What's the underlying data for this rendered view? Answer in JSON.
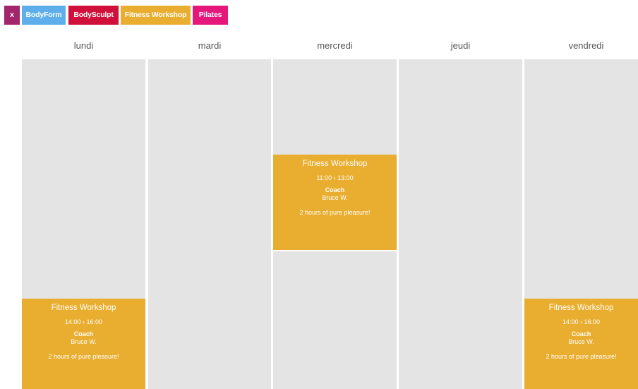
{
  "filters": [
    {
      "label": "x",
      "color": "#a3256c"
    },
    {
      "label": "BodyForm",
      "color": "#5daeea"
    },
    {
      "label": "BodySculpt",
      "color": "#d0103a"
    },
    {
      "label": "Fitness Workshop",
      "color": "#e9ad2f"
    },
    {
      "label": "Pilates",
      "color": "#e5177b"
    }
  ],
  "days": [
    "lundi",
    "mardi",
    "mercredi",
    "jeudi",
    "vendredi"
  ],
  "events": [
    {
      "day": "lundi",
      "title": "Fitness Workshop",
      "time": "14:00 › 16:00",
      "role": "Coach",
      "name": "Bruce W.",
      "description": "2 hours of pure pleasure!"
    },
    {
      "day": "mercredi",
      "title": "Fitness Workshop",
      "time": "11:00 › 13:00",
      "role": "Coach",
      "name": "Bruce W.",
      "description": "2 hours of pure pleasure!"
    },
    {
      "day": "vendredi",
      "title": "Fitness Workshop",
      "time": "14:00 › 16:00",
      "role": "Coach",
      "name": "Bruce W.",
      "description": "2 hours of pure pleasure!"
    }
  ],
  "event_color": "#e9ad2f"
}
